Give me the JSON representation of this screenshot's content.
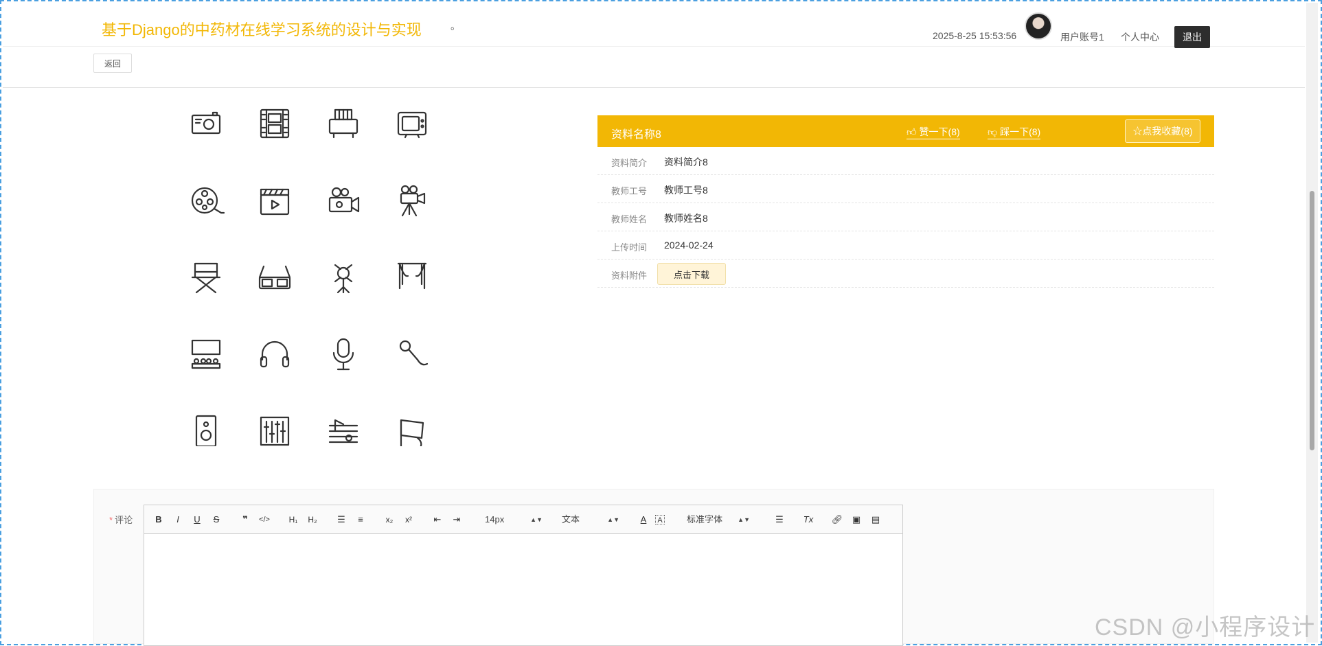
{
  "header": {
    "site_title": "基于Django的中药材在线学习系统的设计与实现",
    "title_dot": "。",
    "datetime": "2025-8-25 15:53:56",
    "username": "用户账号1",
    "personal_center": "个人中心",
    "logout": "退出"
  },
  "nav": {
    "back": "返回"
  },
  "gallery": {
    "icons": [
      "camera-icon",
      "film-strip-icon",
      "printer-icon",
      "tv-icon",
      "film-reel-icon",
      "clapperboard-icon",
      "video-camera-icon",
      "movie-projector-icon",
      "director-chair-icon",
      "3d-glasses-icon",
      "spotlight-icon",
      "theater-curtain-icon",
      "cinema-seats-icon",
      "headphones-icon",
      "studio-microphone-icon",
      "handheld-microphone-icon",
      "speaker-icon",
      "mixer-icon",
      "music-notes-icon",
      "music-flag-icon"
    ]
  },
  "material": {
    "name": "资料名称8",
    "like": "赞一下(8)",
    "dislike": "踩一下(8)",
    "favorite": "☆点我收藏(8)",
    "rows": [
      {
        "label": "资料简介",
        "value": "资料简介8"
      },
      {
        "label": "教师工号",
        "value": "教师工号8"
      },
      {
        "label": "教师姓名",
        "value": "教师姓名8"
      },
      {
        "label": "上传时间",
        "value": "2024-02-24"
      }
    ],
    "attachment_label": "资料附件",
    "download": "点击下载"
  },
  "comment": {
    "required_mark": "*",
    "label": "评论",
    "font_size": "14px",
    "text_type": "文本",
    "font_family": "标准字体"
  },
  "watermark": "CSDN @小程序设计"
}
